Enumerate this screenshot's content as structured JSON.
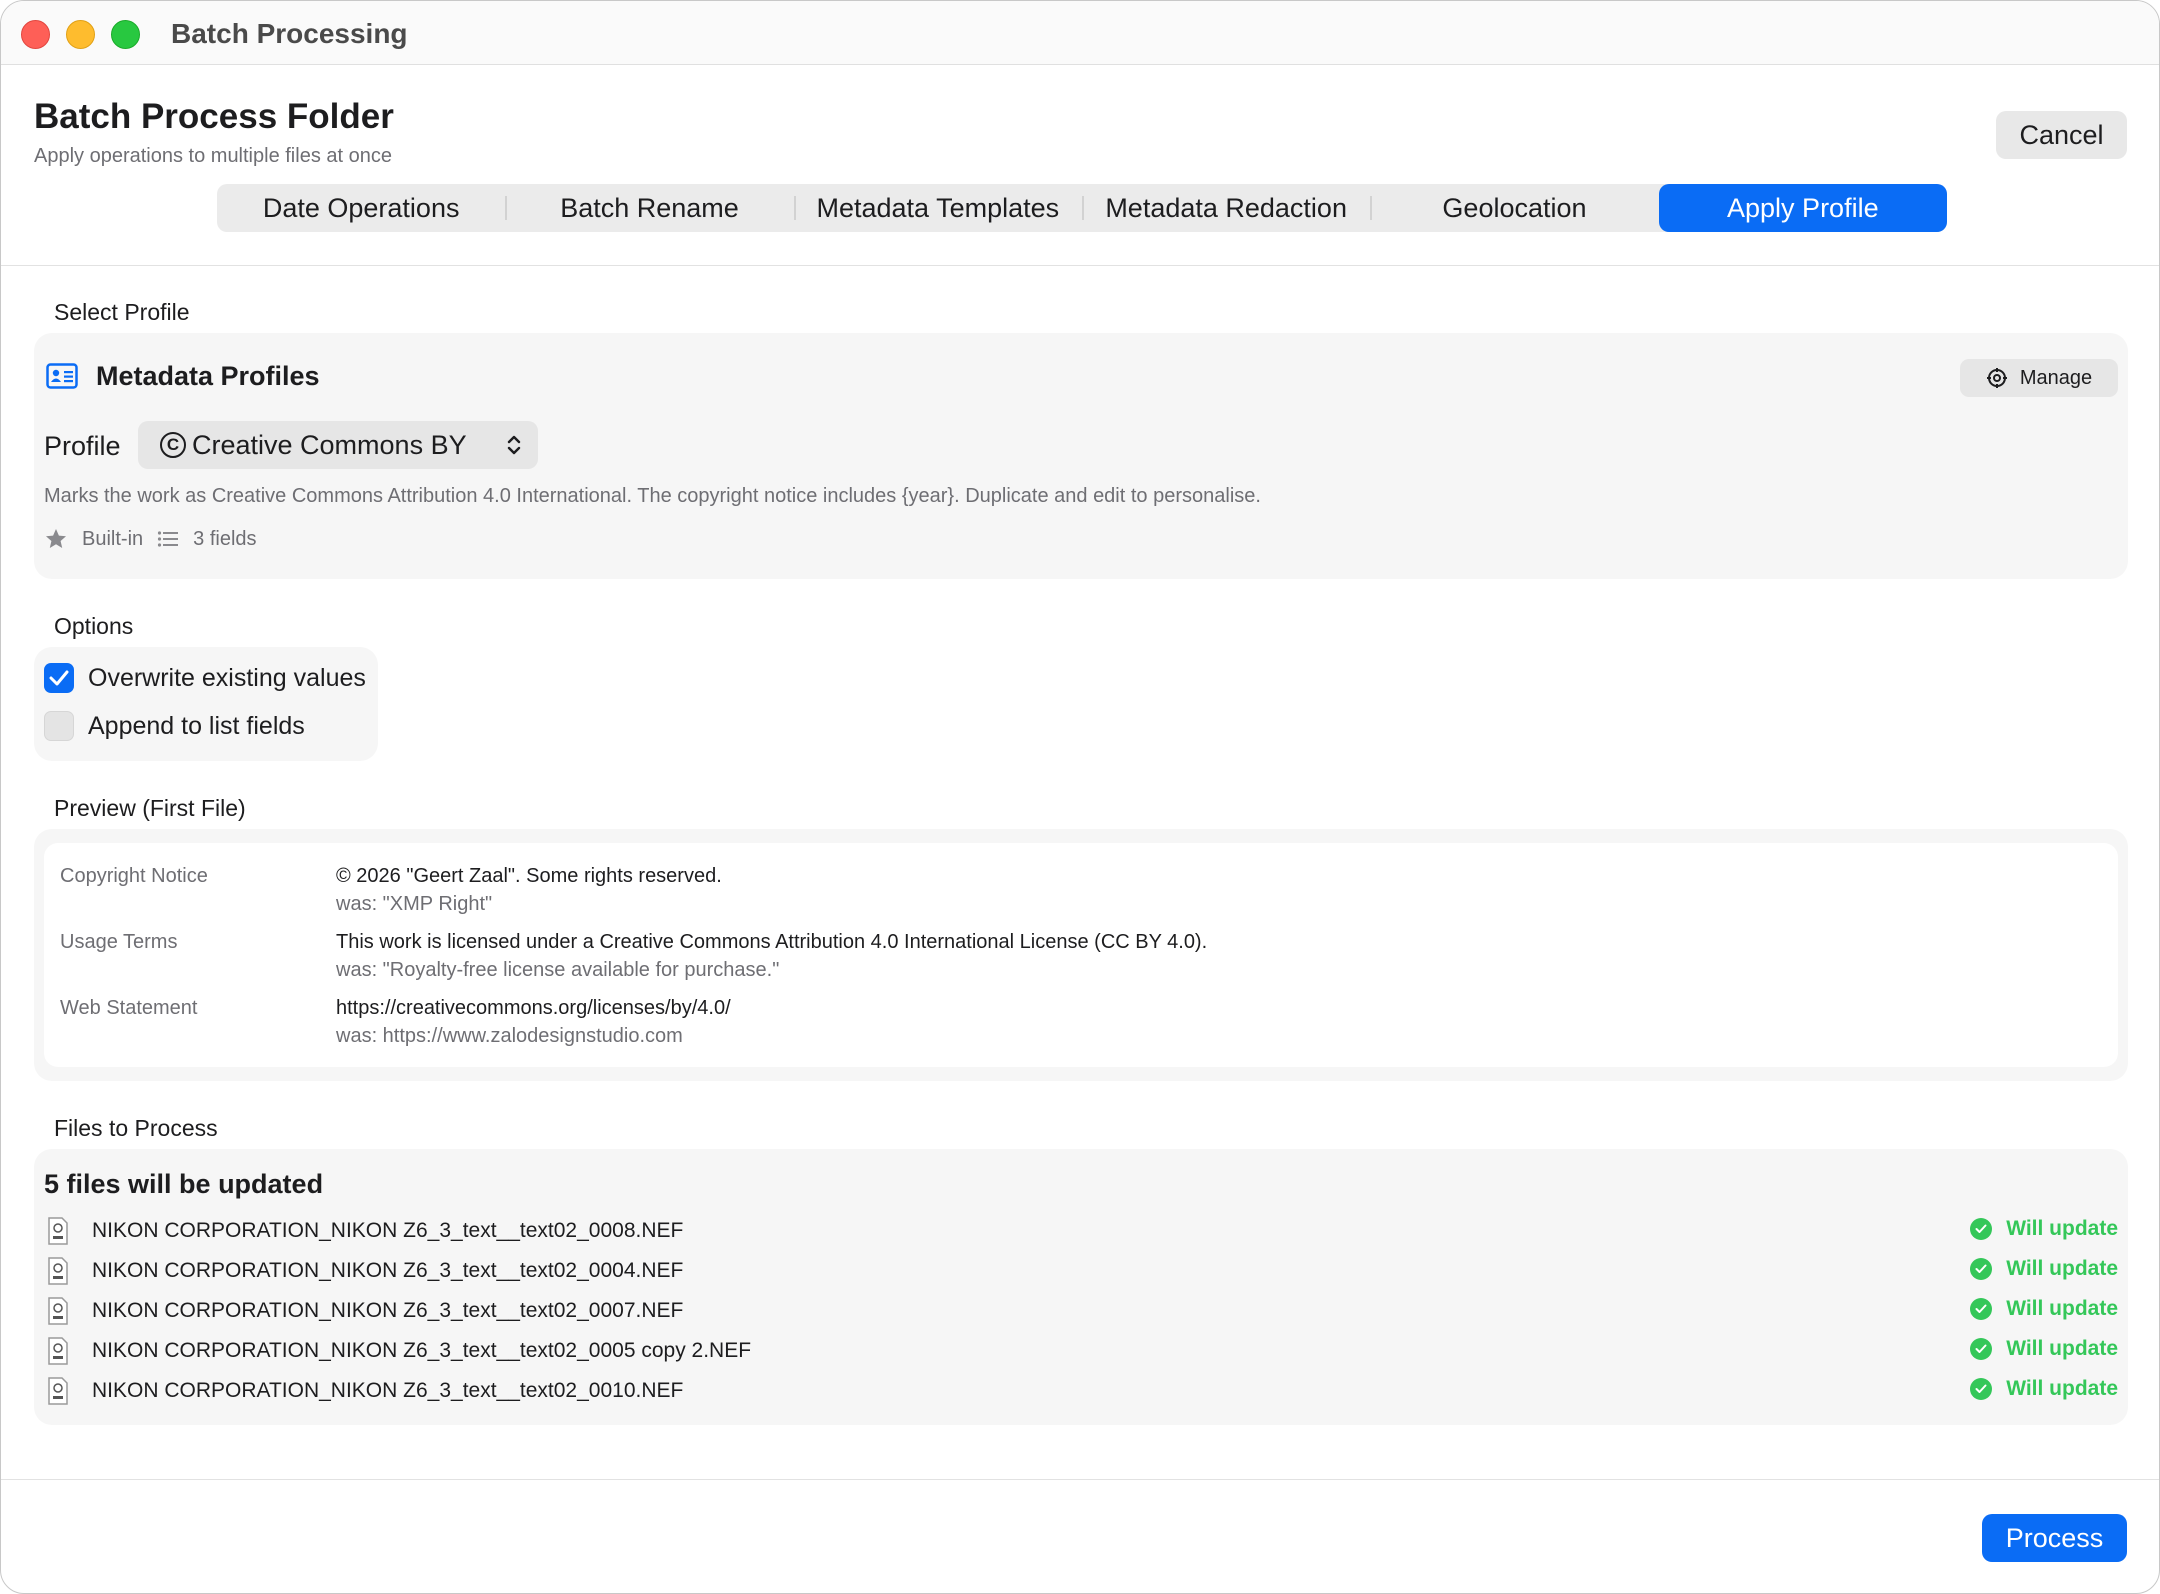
{
  "window": {
    "title": "Batch Processing"
  },
  "header": {
    "title": "Batch Process Folder",
    "subtitle": "Apply operations to multiple files at once",
    "cancel_label": "Cancel"
  },
  "tabs": [
    {
      "label": "Date Operations",
      "active": false
    },
    {
      "label": "Batch Rename",
      "active": false
    },
    {
      "label": "Metadata Templates",
      "active": false
    },
    {
      "label": "Metadata Redaction",
      "active": false
    },
    {
      "label": "Geolocation",
      "active": false
    },
    {
      "label": "Apply Profile",
      "active": true
    }
  ],
  "select_profile": {
    "section_label": "Select Profile",
    "card_title": "Metadata Profiles",
    "manage_label": "Manage",
    "profile_label": "Profile",
    "selected_profile": "Creative Commons BY",
    "description": "Marks the work as Creative Commons Attribution 4.0 International. The copyright notice includes {year}. Duplicate and edit to personalise.",
    "built_in_label": "Built-in",
    "fields_count_label": "3 fields"
  },
  "options": {
    "section_label": "Options",
    "items": [
      {
        "label": "Overwrite existing values",
        "checked": true
      },
      {
        "label": "Append to list fields",
        "checked": false
      }
    ]
  },
  "preview": {
    "section_label": "Preview (First File)",
    "rows": [
      {
        "label": "Copyright Notice",
        "value": "© 2026 \"Geert Zaal\". Some rights reserved.",
        "was": "was: \"XMP Right\""
      },
      {
        "label": "Usage Terms",
        "value": "This work is licensed under a Creative Commons Attribution 4.0 International License (CC BY 4.0).",
        "was": "was: \"Royalty-free license available for purchase.\""
      },
      {
        "label": "Web Statement",
        "value": "https://creativecommons.org/licenses/by/4.0/",
        "was": "was: https://www.zalodesignstudio.com"
      }
    ]
  },
  "files": {
    "section_label": "Files to Process",
    "summary": "5 files will be updated",
    "items": [
      {
        "name": "NIKON CORPORATION_NIKON Z6_3_text__text02_0008.NEF",
        "status": "Will update"
      },
      {
        "name": "NIKON CORPORATION_NIKON Z6_3_text__text02_0004.NEF",
        "status": "Will update"
      },
      {
        "name": "NIKON CORPORATION_NIKON Z6_3_text__text02_0007.NEF",
        "status": "Will update"
      },
      {
        "name": "NIKON CORPORATION_NIKON Z6_3_text__text02_0005 copy 2.NEF",
        "status": "Will update"
      },
      {
        "name": "NIKON CORPORATION_NIKON Z6_3_text__text02_0010.NEF",
        "status": "Will update"
      }
    ]
  },
  "footer": {
    "process_label": "Process"
  },
  "colors": {
    "accent": "#0a6cf5",
    "success": "#34c759"
  },
  "icons": [
    "close-icon",
    "minimize-icon",
    "zoom-icon",
    "contact-card-icon",
    "gear-icon",
    "copyright-icon",
    "chevron-updown-icon",
    "star-icon",
    "list-icon",
    "checkmark-icon",
    "nef-file-icon",
    "checkmark-circle-icon"
  ]
}
